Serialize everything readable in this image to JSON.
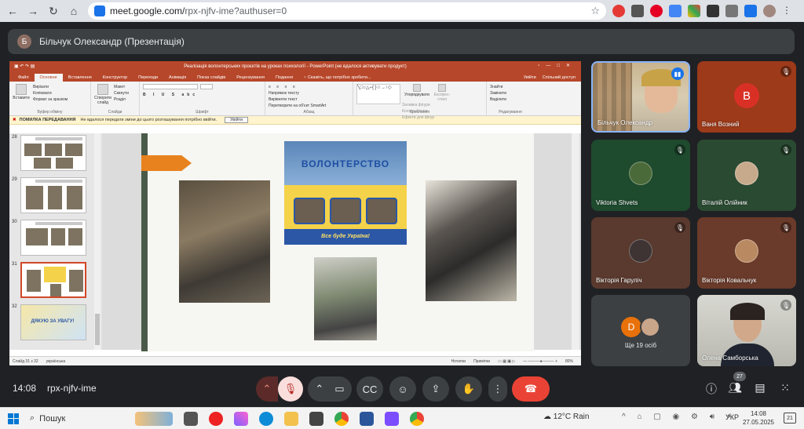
{
  "browser": {
    "url_host": "meet.google.com/",
    "url_path": "rpx-njfv-ime?authuser=0"
  },
  "meet": {
    "presenter_avatar_letter": "Б",
    "presenter_label": "Більчук Олександр (Презентація)",
    "time": "14:08",
    "code": "rpx-njfv-ime",
    "people_count": "27"
  },
  "powerpoint": {
    "title": "Реалізація волонтерських проєктів на уроках психології - PowerPoint (не вдалося активувати продукт)",
    "tabs": [
      "Файл",
      "Основне",
      "Вставлення",
      "Конструктор",
      "Переходи",
      "Анімація",
      "Показ слайдів",
      "Рецензування",
      "Подання"
    ],
    "tell_me": "Скажіть, що потрібно зробити...",
    "sign_in": "Увійти",
    "share": "Спільний доступ",
    "ribbon": {
      "clipboard": {
        "paste": "Вставити",
        "cut": "Вирізати",
        "copy": "Копіювати",
        "format": "Формат за зразком",
        "name": "Буфер обміну"
      },
      "slides": {
        "new": "Створити слайд",
        "layout": "Макет",
        "reset": "Скинути",
        "section": "Розділ",
        "name": "Слайди"
      },
      "font": {
        "name": "Шрифт"
      },
      "paragraph": {
        "direction": "Напрямок тексту",
        "align": "Вирівняти текст",
        "smartart": "Перетворити на об'єкт SmartArt",
        "name": "Абзац"
      },
      "drawing": {
        "arrange": "Упорядкувати",
        "styles": "Експрес-стилі",
        "fill": "Заливка фігури",
        "outline": "Контур фігури",
        "effects": "Ефекти для фігур",
        "name": "Креслення"
      },
      "editing": {
        "find": "Знайти",
        "replace": "Замінити",
        "select": "Виділити",
        "name": "Редагування"
      }
    },
    "error_bar": {
      "label": "ПОМИЛКА ПЕРЕДАВАННЯ",
      "message": "Не вдалося передати зміни до цього розташування потрібно ввійти.",
      "button": "Увійти"
    },
    "thumbs": [
      {
        "num": "28",
        "title": "Проєкт «Великодні кейси» (5 клас)"
      },
      {
        "num": "29",
        "title": "Проєкт «Вітальня» (7–8 клас)"
      },
      {
        "num": "30",
        "title": "Проєкт «Шкарпетки-свічки» (6–7 клас)"
      },
      {
        "num": "31",
        "title": ""
      },
      {
        "num": "32",
        "title": "ДЯКУЮ ЗА УВАГУ!"
      }
    ],
    "slide": {
      "banner_title": "ВОЛОНТЕРСТВО",
      "banner_slogan": "Все буде Україна!"
    },
    "status": {
      "slide": "Слайд 31 з 32",
      "lang": "українська",
      "notes": "Нотатки",
      "comments": "Примітки",
      "zoom": "80%"
    }
  },
  "participants": [
    {
      "name": "Більчук Олександр"
    },
    {
      "name": "Ваня Возний",
      "letter": "В"
    },
    {
      "name": "Viktoria Shvets"
    },
    {
      "name": "Віталій Олійник"
    },
    {
      "name": "Вікторія Гаруліч"
    },
    {
      "name": "Вікторія Ковальчук"
    },
    {
      "name": "Ще 19 осіб",
      "letter": "D"
    },
    {
      "name": "Олена Самборська"
    }
  ],
  "taskbar": {
    "search": "Пошук",
    "weather": "12°C Rain",
    "lang": "УКР",
    "time": "14:08",
    "date": "27.05.2025",
    "notif": "21"
  }
}
